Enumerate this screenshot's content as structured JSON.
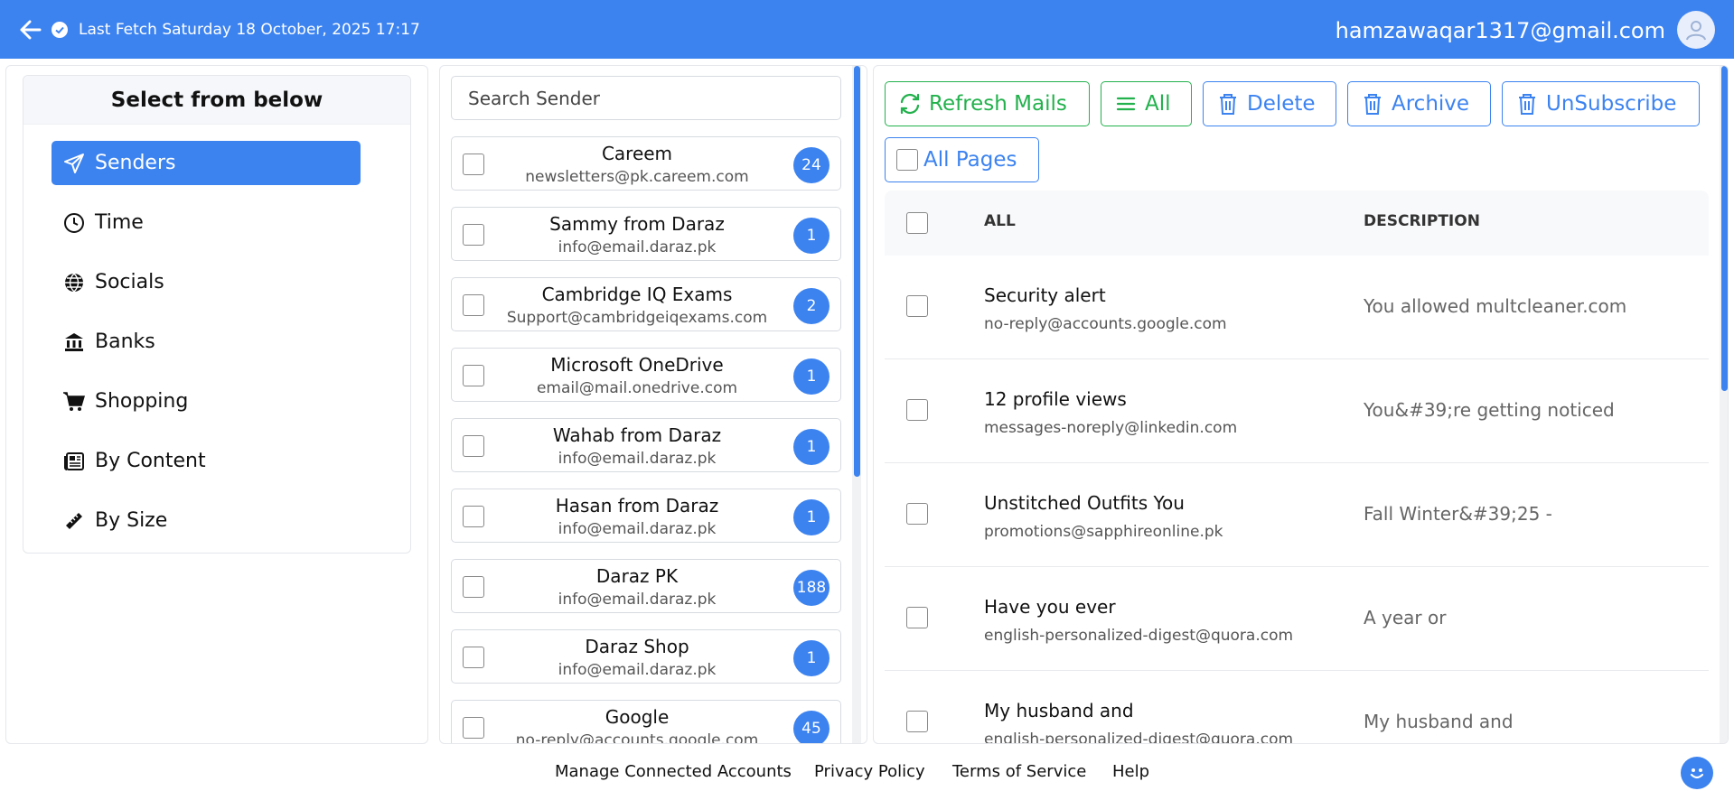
{
  "header": {
    "fetch_text": "Last Fetch Saturday 18 October, 2025 17:17",
    "user_email": "hamzawaqar1317@gmail.com"
  },
  "colors": {
    "primary": "#3c83f0",
    "success": "#22b14c"
  },
  "categories": {
    "title": "Select from below",
    "items": [
      {
        "label": "Senders",
        "icon": "paper-plane-icon",
        "active": true
      },
      {
        "label": "Time",
        "icon": "clock-icon"
      },
      {
        "label": "Socials",
        "icon": "globe-icon"
      },
      {
        "label": "Banks",
        "icon": "bank-icon"
      },
      {
        "label": "Shopping",
        "icon": "cart-icon"
      },
      {
        "label": "By Content",
        "icon": "newspaper-icon"
      },
      {
        "label": "By Size",
        "icon": "ruler-icon"
      }
    ]
  },
  "senders": {
    "search_placeholder": "Search Sender",
    "items": [
      {
        "name": "Careem",
        "email": "newsletters@pk.careem.com",
        "count": "24"
      },
      {
        "name": "Sammy from Daraz",
        "email": "info@email.daraz.pk",
        "count": "1"
      },
      {
        "name": "Cambridge IQ Exams",
        "email": "Support@cambridgeiqexams.com",
        "count": "2"
      },
      {
        "name": "Microsoft OneDrive",
        "email": "email@mail.onedrive.com",
        "count": "1"
      },
      {
        "name": "Wahab from Daraz",
        "email": "info@email.daraz.pk",
        "count": "1"
      },
      {
        "name": "Hasan from Daraz",
        "email": "info@email.daraz.pk",
        "count": "1"
      },
      {
        "name": "Daraz PK",
        "email": "info@email.daraz.pk",
        "count": "188"
      },
      {
        "name": "Daraz Shop",
        "email": "info@email.daraz.pk",
        "count": "1"
      },
      {
        "name": "Google",
        "email": "no-reply@accounts.google.com",
        "count": "45"
      }
    ]
  },
  "toolbar": {
    "refresh": "Refresh Mails",
    "all": "All",
    "delete": "Delete",
    "archive": "Archive",
    "unsubscribe": "UnSubscribe",
    "all_pages": "All Pages"
  },
  "mail_table": {
    "col_all": "ALL",
    "col_description": "DESCRIPTION",
    "rows": [
      {
        "subject": "Security alert",
        "from": "no-reply@accounts.google.com",
        "description": "You allowed multcleaner.com"
      },
      {
        "subject": "12 profile views",
        "from": "messages-noreply@linkedin.com",
        "description": "You&#39;re getting noticed"
      },
      {
        "subject": "Unstitched Outfits You",
        "from": "promotions@sapphireonline.pk",
        "description": "Fall Winter&#39;25 -"
      },
      {
        "subject": "Have you ever",
        "from": "english-personalized-digest@quora.com",
        "description": "A year or"
      },
      {
        "subject": "My husband and",
        "from": "english-personalized-digest@quora.com",
        "description": "My husband and"
      }
    ]
  },
  "footer": {
    "links": [
      "Manage Connected Accounts",
      "Privacy Policy",
      "Terms of Service",
      "Help"
    ]
  }
}
